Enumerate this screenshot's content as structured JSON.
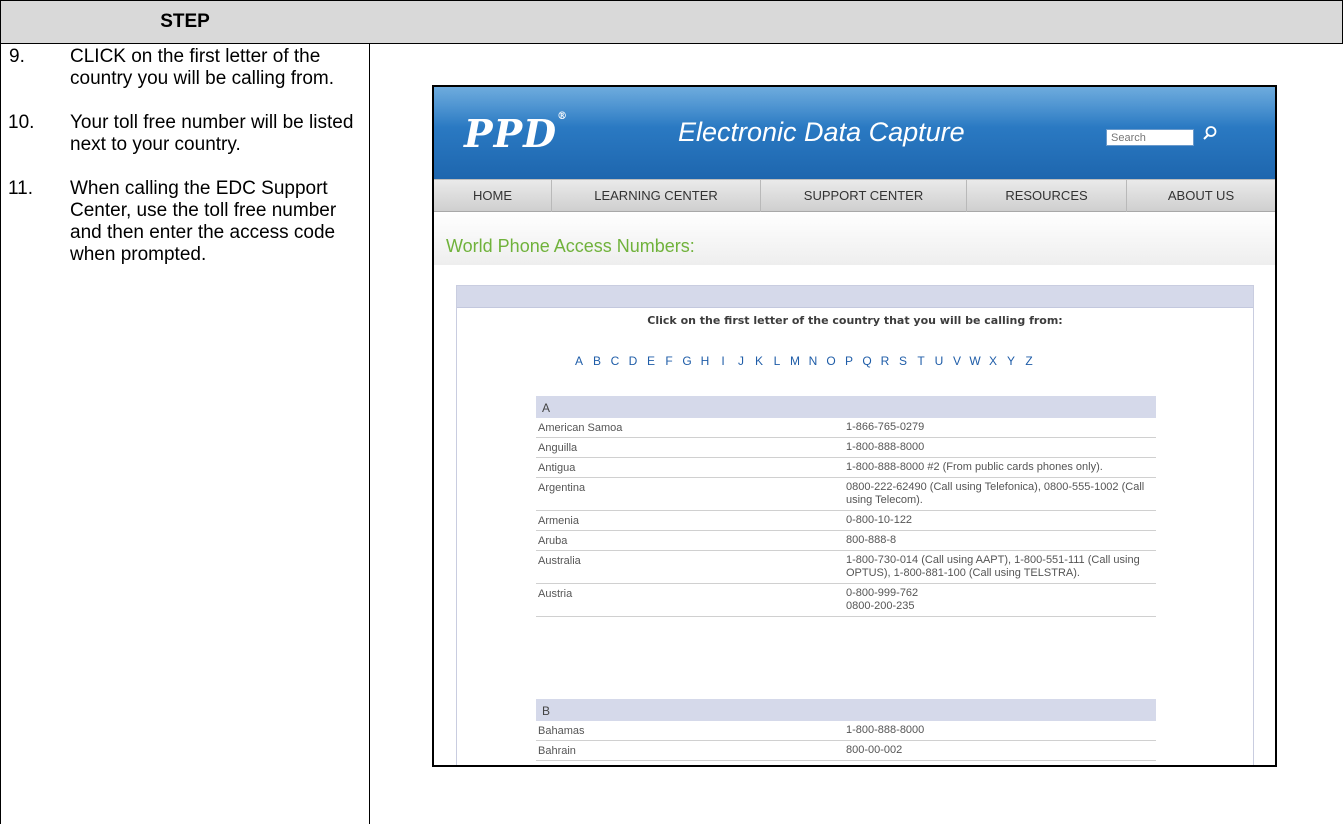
{
  "doc": {
    "header": {
      "step_label": "STEP"
    },
    "steps": [
      {
        "num": "9.",
        "text": "CLICK on the first letter of the country you will be calling from."
      },
      {
        "num": "10.",
        "text": "Your toll free number will be listed next to your country."
      },
      {
        "num": "11.",
        "text": "When calling the EDC Support Center, use the toll free number and then enter the access code when prompted."
      }
    ]
  },
  "app": {
    "logo": "PPD",
    "logo_mark": "®",
    "title": "Electronic Data Capture",
    "search_placeholder": "Search",
    "search_icon": "magnifier-icon",
    "nav": [
      "HOME",
      "LEARNING CENTER",
      "SUPPORT CENTER",
      "RESOURCES",
      "ABOUT US"
    ],
    "page_title": "World Phone Access Numbers:",
    "instruction": "Click on the first letter of the country that you will be calling from:",
    "letters": [
      "A",
      "B",
      "C",
      "D",
      "E",
      "F",
      "G",
      "H",
      "I",
      "J",
      "K",
      "L",
      "M",
      "N",
      "O",
      "P",
      "Q",
      "R",
      "S",
      "T",
      "U",
      "V",
      "W",
      "X",
      "Y",
      "Z"
    ],
    "groups": [
      {
        "letter": "A",
        "rows": [
          {
            "country": "American Samoa",
            "number": "1-866-765-0279"
          },
          {
            "country": "Anguilla",
            "number": "1-800-888-8000"
          },
          {
            "country": "Antigua",
            "number": "1-800-888-8000 #2 (From public cards phones only)."
          },
          {
            "country": "Argentina",
            "number": "0800-222-62490 (Call using Telefonica), 0800-555-1002 (Call using Telecom)."
          },
          {
            "country": "Armenia",
            "number": "0-800-10-122"
          },
          {
            "country": "Aruba",
            "number": "800-888-8"
          },
          {
            "country": "Australia",
            "number": "1-800-730-014 (Call using AAPT), 1-800-551-111 (Call using OPTUS), 1-800-881-100 (Call using TELSTRA)."
          },
          {
            "country": "Austria",
            "number": "0-800-999-762\n0800-200-235"
          }
        ]
      },
      {
        "letter": "B",
        "rows": [
          {
            "country": "Bahamas",
            "number": "1-800-888-8000"
          },
          {
            "country": "Bahrain",
            "number": "800-00-002"
          }
        ]
      }
    ]
  },
  "colors": {
    "banner": "#2a79c2",
    "title_green": "#70b23b",
    "letter_blue": "#1f5da8",
    "group_header": "#d5d9ea"
  }
}
